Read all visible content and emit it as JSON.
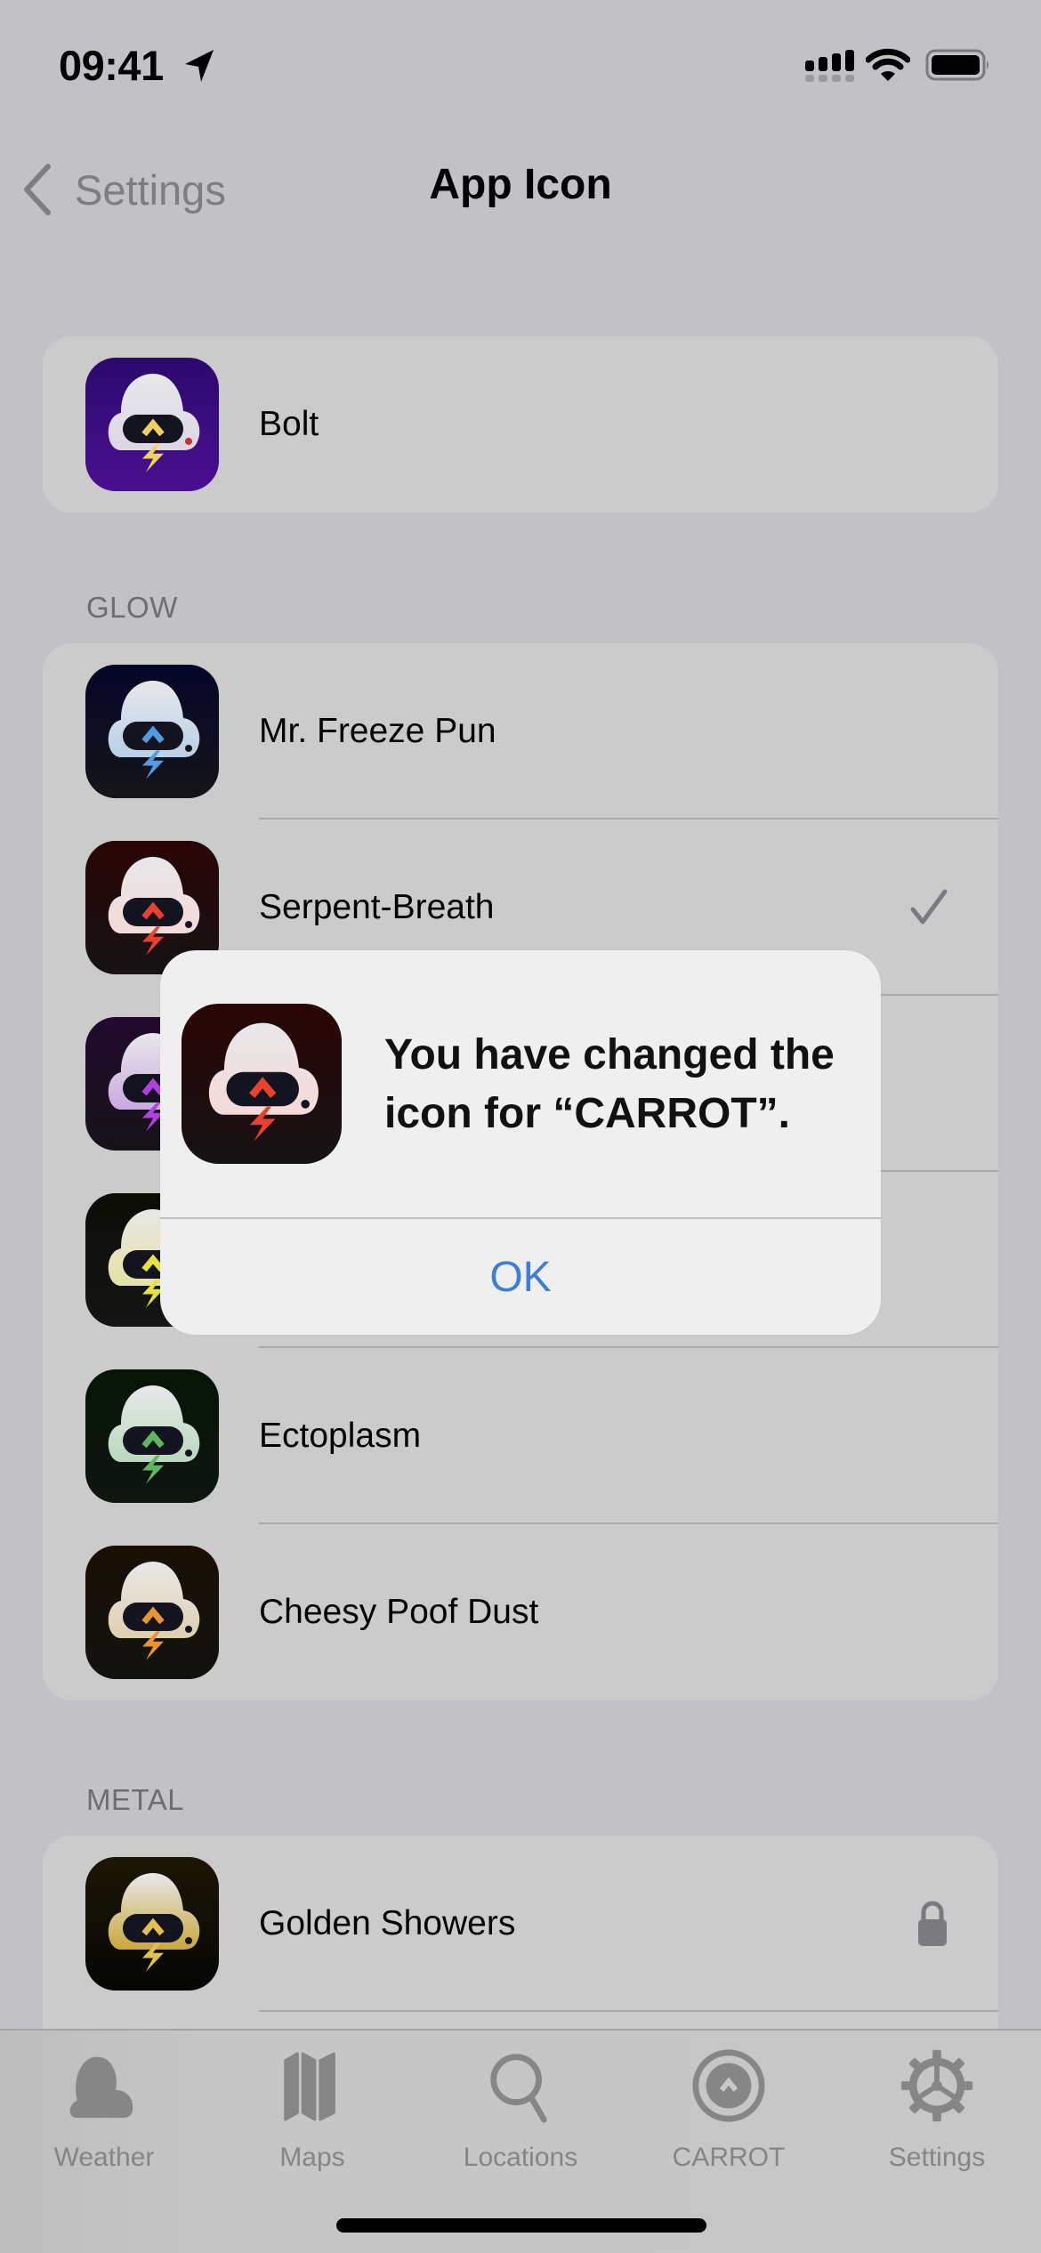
{
  "status_bar": {
    "time": "09:41",
    "icons": [
      "location-arrow-icon",
      "cellular-signal-icon",
      "wifi-icon",
      "battery-icon"
    ]
  },
  "nav": {
    "back_label": "Settings",
    "title": "App Icon"
  },
  "sections": [
    {
      "header": "",
      "items": [
        {
          "label": "Bolt",
          "theme": "bolt",
          "bg_top": "#2a0a6e",
          "bg_bottom": "#4a0f90",
          "cloud": "#dcd6e6",
          "accent": "#f0d060",
          "selected": false,
          "locked": false
        }
      ]
    },
    {
      "header": "GLOW",
      "items": [
        {
          "label": "Mr. Freeze Pun",
          "theme": "freeze",
          "bg_top": "#05052a",
          "bg_bottom": "#151518",
          "cloud": "#b8d0e8",
          "accent": "#4f9de0",
          "selected": false,
          "locked": false
        },
        {
          "label": "Serpent-Breath",
          "theme": "serpent",
          "bg_top": "#2a0505",
          "bg_bottom": "#161315",
          "cloud": "#f5d9d8",
          "accent": "#e8412e",
          "selected": true,
          "locked": false
        },
        {
          "label": "",
          "theme": "purple",
          "bg_top": "#230a2e",
          "bg_bottom": "#151318",
          "cloud": "#c9a9e0",
          "accent": "#b040e0",
          "selected": false,
          "locked": false
        },
        {
          "label": "",
          "theme": "yellow",
          "bg_top": "#0c0c06",
          "bg_bottom": "#151515",
          "cloud": "#e6e2a0",
          "accent": "#e8e040",
          "selected": false,
          "locked": false
        },
        {
          "label": "Ectoplasm",
          "theme": "ecto",
          "bg_top": "#051505",
          "bg_bottom": "#101511",
          "cloud": "#b9d9be",
          "accent": "#5fb860",
          "selected": false,
          "locked": false
        },
        {
          "label": "Cheesy Poof Dust",
          "theme": "cheesy",
          "bg_top": "#1a1005",
          "bg_bottom": "#121210",
          "cloud": "#e0cfae",
          "accent": "#e89430",
          "selected": false,
          "locked": false
        }
      ]
    },
    {
      "header": "METAL",
      "items": [
        {
          "label": "Golden Showers",
          "theme": "gold",
          "bg_top": "#1c1703",
          "bg_bottom": "#050505",
          "cloud": "#c8a838",
          "accent": "#e0c050",
          "selected": false,
          "locked": true
        }
      ]
    }
  ],
  "alert": {
    "message": "You have changed the icon for “CARROT”.",
    "ok_label": "OK",
    "icon_theme": "serpent"
  },
  "tab_bar": {
    "tabs": [
      {
        "label": "Weather",
        "icon": "weather-cloud-icon"
      },
      {
        "label": "Maps",
        "icon": "map-icon"
      },
      {
        "label": "Locations",
        "icon": "search-icon"
      },
      {
        "label": "CARROT",
        "icon": "carrot-logo-icon"
      },
      {
        "label": "Settings",
        "icon": "gear-icon"
      }
    ]
  },
  "colors": {
    "background": "#c2c1c6",
    "card": "#cbcbcb",
    "alert_button": "#3d7fd4",
    "secondary_text": "#7e7d82"
  }
}
